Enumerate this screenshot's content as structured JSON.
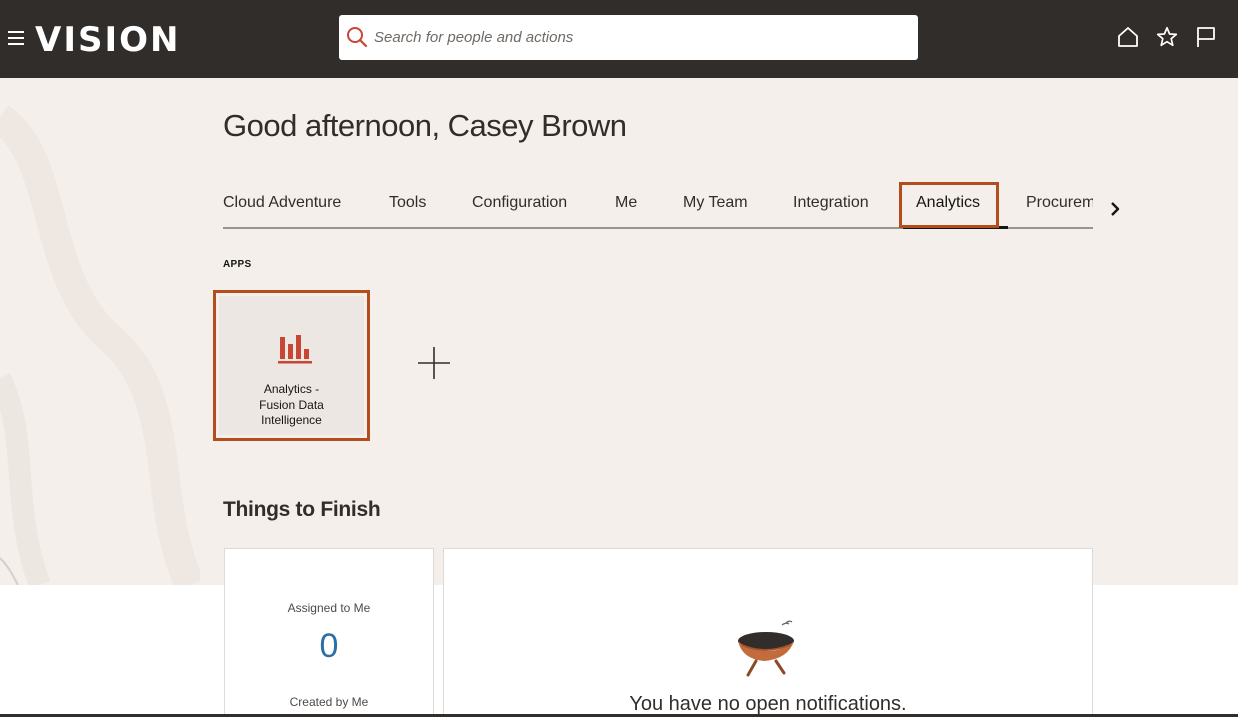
{
  "header": {
    "logo": "VISION",
    "search_placeholder": "Search for people and actions",
    "icons": [
      "menu-icon",
      "search-icon",
      "home-icon",
      "star-icon",
      "flag-icon"
    ]
  },
  "greeting": "Good afternoon, Casey Brown",
  "tabs": [
    {
      "label": "Cloud Adventure"
    },
    {
      "label": "Tools"
    },
    {
      "label": "Configuration"
    },
    {
      "label": "Me"
    },
    {
      "label": "My Team"
    },
    {
      "label": "Integration"
    },
    {
      "label": "Analytics",
      "active": true
    },
    {
      "label": "Procurem"
    }
  ],
  "apps": {
    "heading": "APPS",
    "items": [
      {
        "line1": "Analytics -",
        "line2": "Fusion Data",
        "line3": "Intelligence",
        "icon": "bar-chart-icon"
      }
    ],
    "add_icon": "plus-icon"
  },
  "things_to_finish": {
    "title": "Things to Finish",
    "assigned_label": "Assigned to Me",
    "assigned_count": "0",
    "created_label": "Created by Me",
    "empty_message": "You have no open notifications."
  },
  "colors": {
    "header_bg": "#312d2a",
    "accent": "#b24e1e",
    "content_bg": "#f4efeb",
    "count_color": "#2c6ea6"
  }
}
